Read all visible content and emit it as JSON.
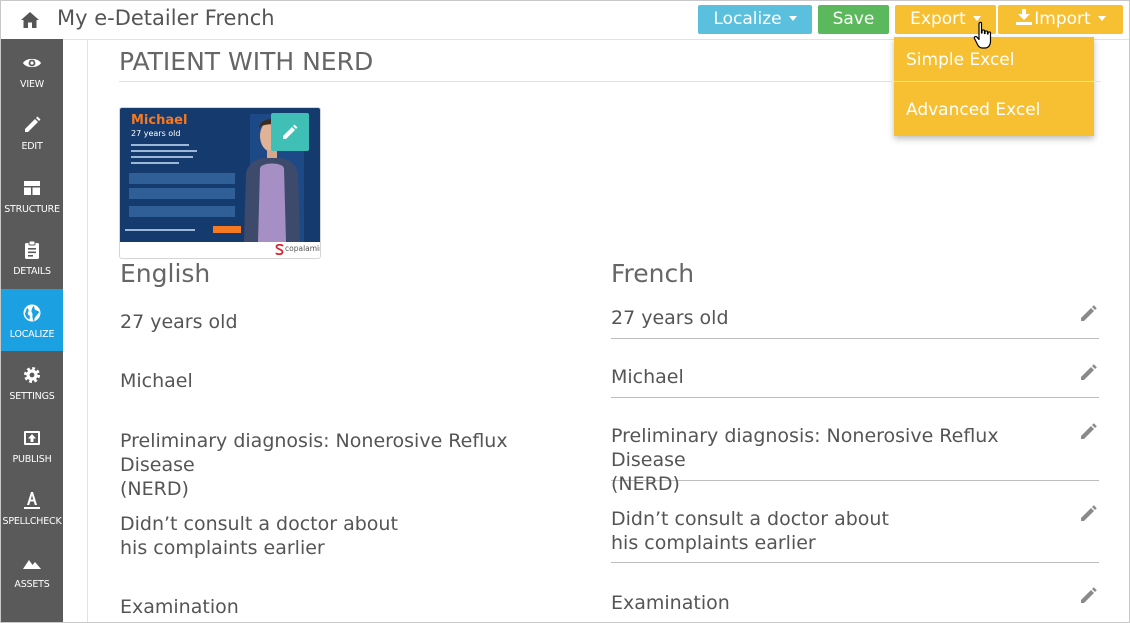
{
  "header": {
    "title": "My e-Detailer French",
    "buttons": {
      "localize": "Localize",
      "save": "Save",
      "export": "Export",
      "import": "Import"
    },
    "export_menu": [
      "Simple Excel",
      "Advanced Excel"
    ]
  },
  "sidebar": {
    "items": [
      {
        "label": "VIEW",
        "icon": "eye-icon"
      },
      {
        "label": "EDIT",
        "icon": "pencil-icon"
      },
      {
        "label": "STRUCTURE",
        "icon": "layout-icon"
      },
      {
        "label": "DETAILS",
        "icon": "clipboard-icon"
      },
      {
        "label": "LOCALIZE",
        "icon": "globe-icon",
        "active": true
      },
      {
        "label": "SETTINGS",
        "icon": "gear-icon"
      },
      {
        "label": "PUBLISH",
        "icon": "upload-icon"
      },
      {
        "label": "SPELLCHECK",
        "icon": "spellcheck-icon"
      },
      {
        "label": "ASSETS",
        "icon": "mountain-icon"
      }
    ]
  },
  "main": {
    "section_title": "PATIENT WITH NERD",
    "thumbnail": {
      "name": "Michael",
      "age": "27 years old",
      "brand": "copalamint"
    },
    "columns": {
      "source": "English",
      "target": "French"
    },
    "rows": [
      {
        "source": "27 years old",
        "target": "27 years old"
      },
      {
        "source": "Michael",
        "target": "Michael"
      },
      {
        "source": "Preliminary diagnosis: Nonerosive Reflux Disease\n(NERD)",
        "target": "Preliminary diagnosis: Nonerosive Reflux Disease\n(NERD)"
      },
      {
        "source": "Didn’t consult a doctor about\nhis complaints earlier",
        "target": "Didn’t consult a doctor about\nhis complaints earlier"
      },
      {
        "source": "Examination",
        "target": "Examination"
      }
    ]
  },
  "colors": {
    "localize": "#5bc0de",
    "save": "#5cb85c",
    "export": "#f7c033",
    "sidebar": "#5a5a5a",
    "active": "#1ba1e2"
  }
}
